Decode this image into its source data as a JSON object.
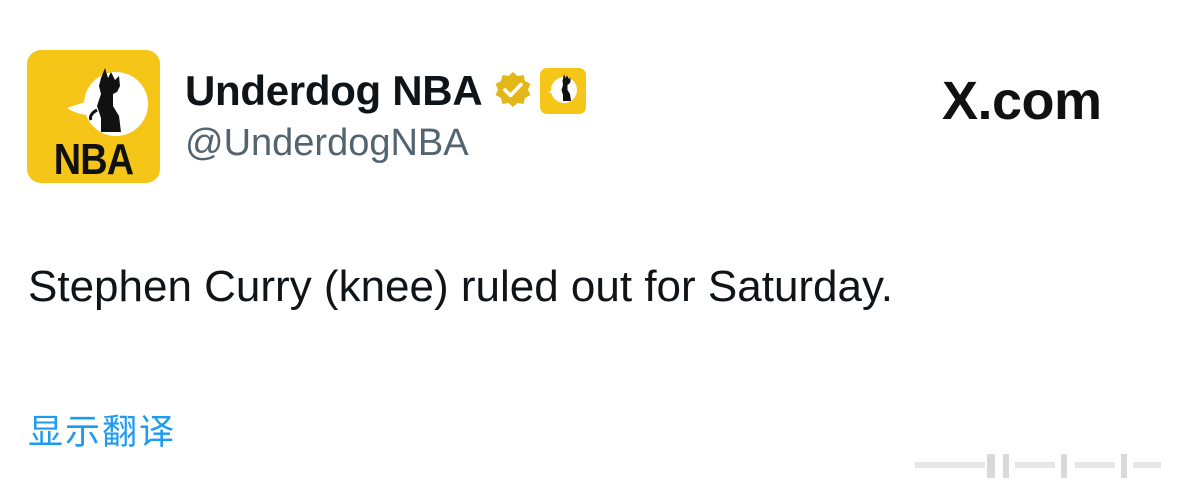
{
  "account": {
    "display_name": "Underdog NBA",
    "handle": "@UnderdogNBA",
    "avatar_text": "NBA",
    "verified_badge_color": "#e2b719",
    "brand_color": "#f5c518"
  },
  "site_label": "X.com",
  "tweet": {
    "text": "Stephen Curry (knee) ruled out for Saturday."
  },
  "translate_link": "显示翻译",
  "colors": {
    "text_primary": "#0f1419",
    "text_secondary": "#536471",
    "link": "#1d9bf0"
  }
}
